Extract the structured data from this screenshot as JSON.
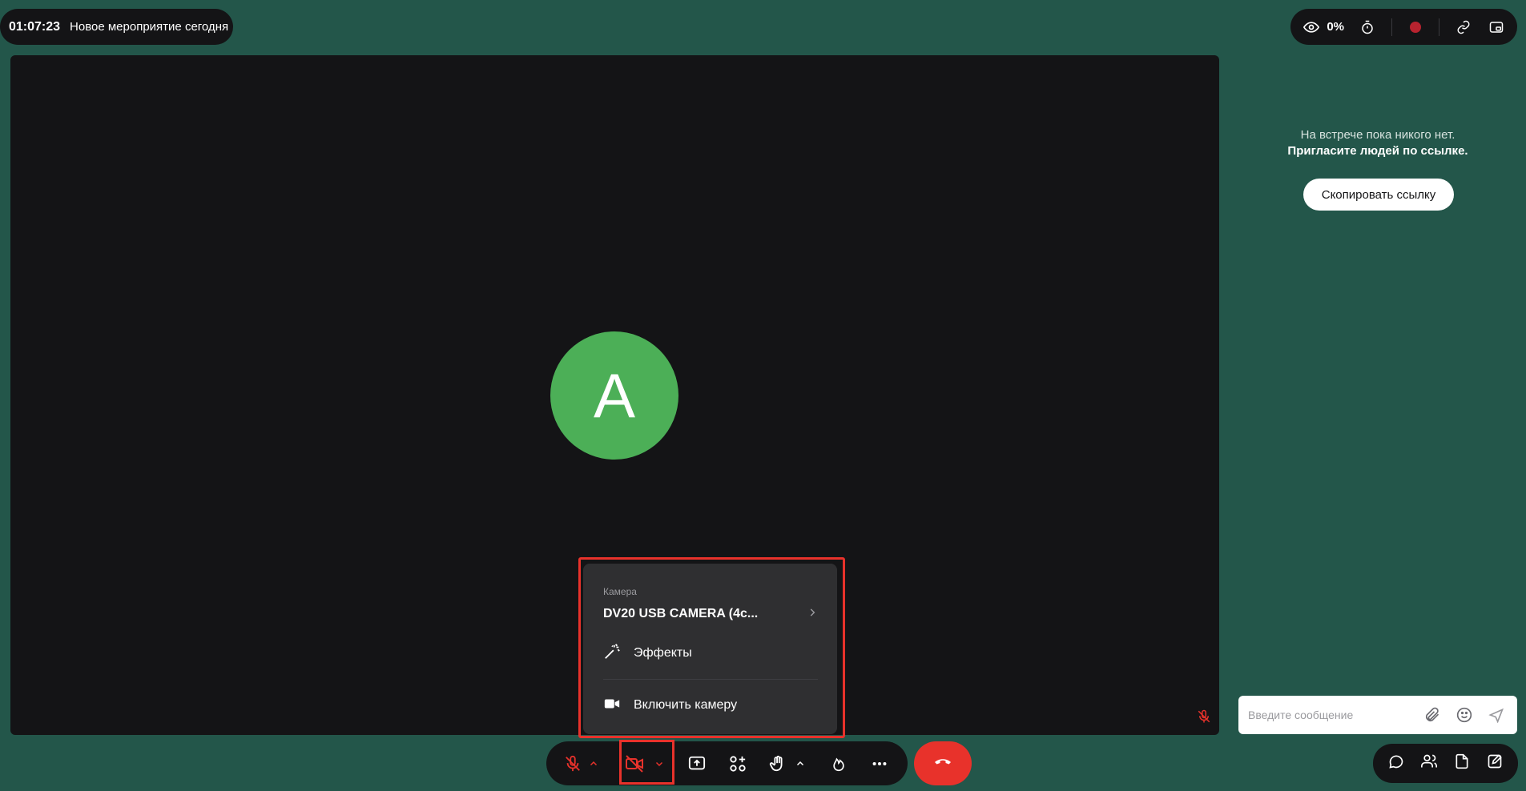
{
  "meeting": {
    "time": "01:07:23",
    "title": "Новое мероприятие сегодня"
  },
  "status": {
    "visibility_percent": "0%"
  },
  "stage": {
    "avatar_letter": "A",
    "avatar_color": "#4caf57"
  },
  "camera_menu": {
    "caption": "Камера",
    "device": "DV20 USB CAMERA (4c...",
    "effects": "Эффекты",
    "enable_camera": "Включить камеру"
  },
  "right_panel": {
    "empty_line1": "На встрече пока никого нет.",
    "empty_line2": "Пригласите людей по ссылке.",
    "copy_link": "Скопировать ссылку"
  },
  "chat": {
    "placeholder": "Введите сообщение"
  },
  "icons": {
    "top_right": [
      "eye-icon",
      "timer-icon",
      "record-icon",
      "link-icon",
      "pip-icon"
    ],
    "toolbar": [
      "mic-off-icon",
      "chevron-up-icon",
      "camera-off-icon",
      "chevron-down-icon",
      "share-screen-icon",
      "apps-icon",
      "raise-hand-icon",
      "chevron-up-icon",
      "reaction-icon",
      "more-icon",
      "hangup-icon"
    ],
    "bottom_right": [
      "chat-icon",
      "participants-icon",
      "files-icon",
      "notes-icon"
    ]
  },
  "colors": {
    "background": "#23564a",
    "panel": "#141416",
    "accent_red": "#e8322b",
    "popup": "#2f2f31"
  }
}
